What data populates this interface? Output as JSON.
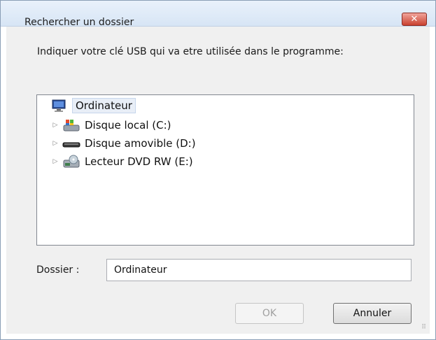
{
  "dialog": {
    "title": "Rechercher un dossier",
    "close_symbol": "✕",
    "instruction": "Indiquer votre clé USB qui va etre utilisée dans le programme:"
  },
  "tree": {
    "root": {
      "label": "Ordinateur",
      "icon": "computer-icon",
      "selected": true
    },
    "items": [
      {
        "label": "Disque local (C:)",
        "icon": "hard-drive-icon",
        "expander": "▷"
      },
      {
        "label": "Disque amovible (D:)",
        "icon": "removable-drive-icon",
        "expander": "▷"
      },
      {
        "label": "Lecteur DVD RW (E:)",
        "icon": "dvd-drive-icon",
        "expander": "▷"
      }
    ]
  },
  "folder": {
    "label": "Dossier :",
    "value": "Ordinateur"
  },
  "buttons": {
    "ok": "OK",
    "cancel": "Annuler"
  },
  "colors": {
    "selection": "#e8eef7",
    "close_button": "#c9412f",
    "dialog_background": "#f0f0f0"
  }
}
